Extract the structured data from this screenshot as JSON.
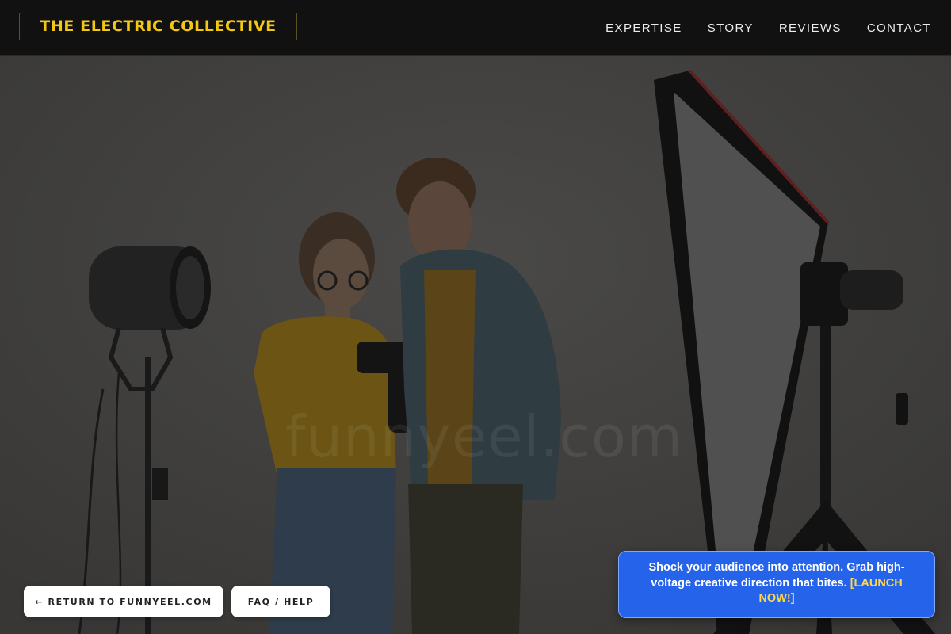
{
  "header": {
    "brand": "THE ELECTRIC COLLECTIVE",
    "nav": [
      "EXPERTISE",
      "STORY",
      "REVIEWS",
      "CONTACT"
    ]
  },
  "hero": {
    "watermark": "funnyeel.com"
  },
  "buttons": {
    "return_label": "← RETURN TO FUNNYEEL.COM",
    "faq_label": "FAQ / HELP"
  },
  "promo": {
    "text": "Shock your audience into attention. Grab high-voltage creative direction that bites. ",
    "cta": "[LAUNCH NOW!]"
  },
  "colors": {
    "brand_yellow": "#f2c813",
    "promo_blue": "#2563eb",
    "cta_yellow": "#ffd84a",
    "header_bg": "#111111"
  }
}
